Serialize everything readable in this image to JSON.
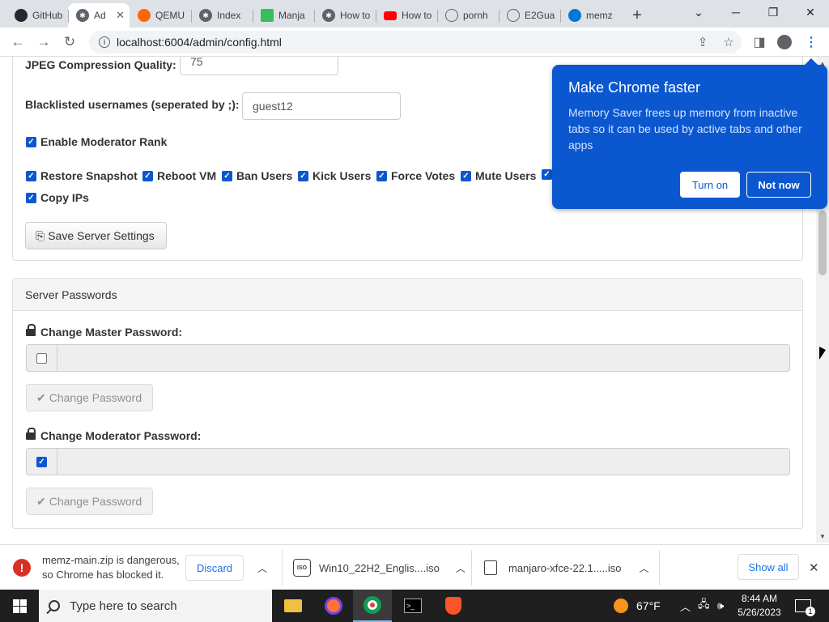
{
  "browser": {
    "tabs": [
      {
        "title": "GitHub",
        "icon": "github-icon",
        "color": "#24292f"
      },
      {
        "title": "Ad",
        "icon": "gear-icon",
        "color": "#5f6368"
      },
      {
        "title": "QEMU",
        "icon": "qemu-icon",
        "color": "#ff6600"
      },
      {
        "title": "Index",
        "icon": "gear-icon",
        "color": "#5f6368"
      },
      {
        "title": "Manja",
        "icon": "manjaro-icon",
        "color": "#35bf5c"
      },
      {
        "title": "How to",
        "icon": "gear-icon",
        "color": "#5f6368"
      },
      {
        "title": "How to",
        "icon": "youtube-icon",
        "color": "#ff0000"
      },
      {
        "title": "pornh",
        "icon": "globe-icon",
        "color": "#5f6368"
      },
      {
        "title": "E2Gua",
        "icon": "globe-icon",
        "color": "#5f6368"
      },
      {
        "title": "memz",
        "icon": "edge-icon",
        "color": "#0078d4"
      }
    ],
    "url": "localhost:6004/admin/config.html"
  },
  "settings": {
    "jpeg_label": "JPEG Compression Quality:",
    "jpeg_value": "75",
    "blacklist_label": "Blacklisted usernames (seperated by ;):",
    "blacklist_value": "guest12",
    "moderator_rank_label": "Enable Moderator Rank",
    "permissions": [
      "Restore Snapshot",
      "Reboot VM",
      "Ban Users",
      "Kick Users",
      "Force Votes",
      "Mute Users",
      "Copy IPs"
    ],
    "save_button": "Save Server Settings"
  },
  "passwords": {
    "heading": "Server Passwords",
    "master_label": "Change Master Password:",
    "moderator_label": "Change Moderator Password:",
    "change_button": "Change Password"
  },
  "popup": {
    "title": "Make Chrome faster",
    "body": "Memory Saver frees up memory from inactive tabs so it can be used by active tabs and other apps",
    "turn_on": "Turn on",
    "not_now": "Not now",
    "color": "#0b57d0"
  },
  "downloads": {
    "items": [
      {
        "name": "memz-main.zip is dangerous,",
        "sub": "so Chrome has blocked it.",
        "action": "Discard"
      },
      {
        "name": "Win10_22H2_Englis....iso"
      },
      {
        "name": "manjaro-xfce-22.1.....iso"
      }
    ],
    "show_all": "Show all"
  },
  "taskbar": {
    "search_placeholder": "Type here to search",
    "weather": "67°F",
    "time": "8:44 AM",
    "date": "5/26/2023",
    "notification_count": "1"
  }
}
